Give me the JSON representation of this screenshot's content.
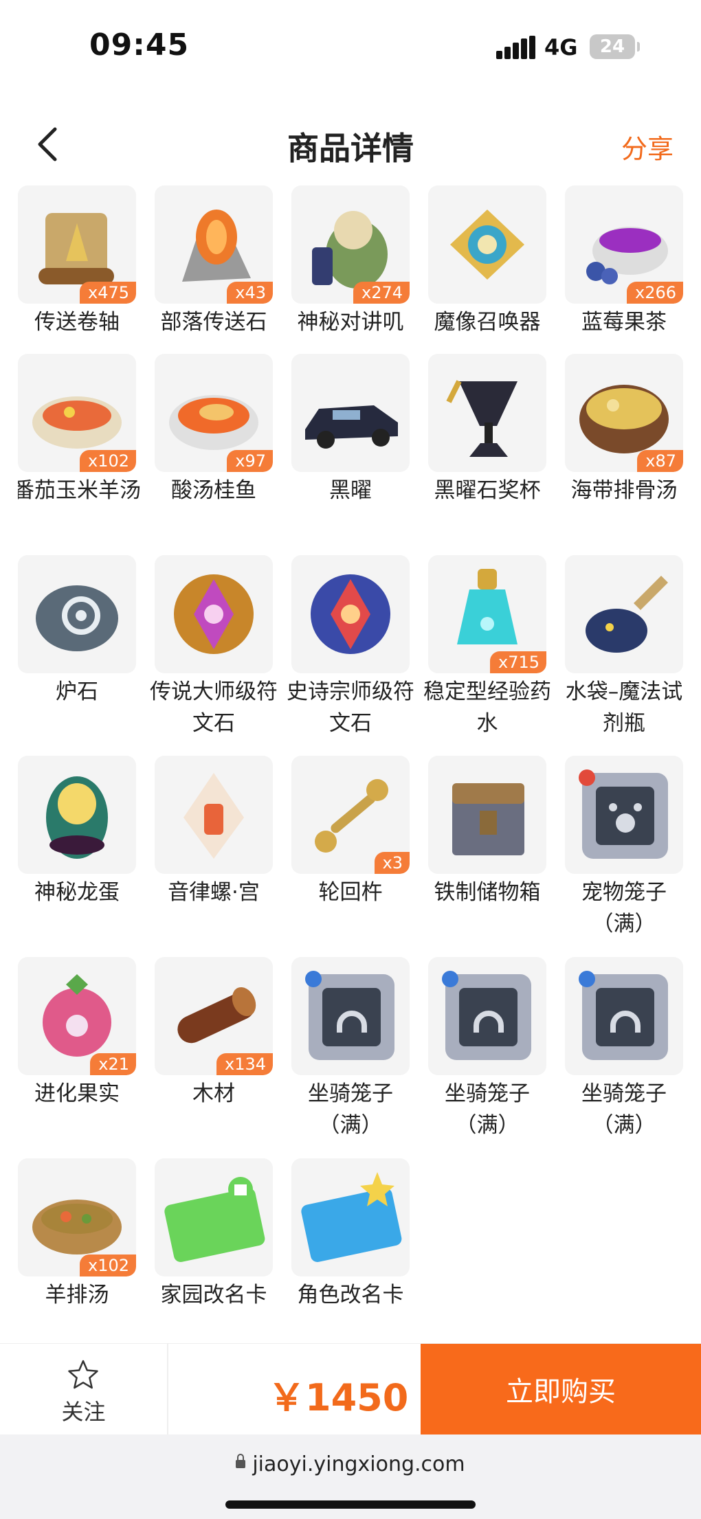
{
  "status_bar": {
    "time": "09:45",
    "network": "4G",
    "battery": "24"
  },
  "header": {
    "title": "商品详情",
    "share_label": "分享"
  },
  "items": [
    {
      "name": "传送卷轴",
      "count": "x475",
      "icon": "scroll-icon"
    },
    {
      "name": "部落传送石",
      "count": "x43",
      "icon": "teleport-stone-icon"
    },
    {
      "name": "神秘对讲叽",
      "count": "x274",
      "icon": "walkie-bird-icon"
    },
    {
      "name": "魔像召唤器",
      "count": "",
      "icon": "golem-summoner-icon"
    },
    {
      "name": "蓝莓果茶",
      "count": "x266",
      "icon": "blueberry-tea-icon"
    },
    {
      "name": "番茄玉米羊汤",
      "count": "x102",
      "icon": "tomato-corn-soup-icon"
    },
    {
      "name": "酸汤桂鱼",
      "count": "x97",
      "icon": "sour-fish-soup-icon"
    },
    {
      "name": "黑曜",
      "count": "",
      "icon": "black-car-icon"
    },
    {
      "name": "黑曜石奖杯",
      "count": "",
      "icon": "obsidian-trophy-icon"
    },
    {
      "name": "海带排骨汤",
      "count": "x87",
      "icon": "kelp-rib-soup-icon"
    },
    {
      "name": "炉石",
      "count": "",
      "icon": "hearthstone-icon"
    },
    {
      "name": "传说大师级符文石",
      "count": "",
      "icon": "legendary-rune-icon"
    },
    {
      "name": "史诗宗师级符文石",
      "count": "",
      "icon": "epic-rune-icon"
    },
    {
      "name": "稳定型经验药水",
      "count": "x715",
      "icon": "exp-potion-icon"
    },
    {
      "name": "水袋–魔法试剂瓶",
      "count": "",
      "icon": "magic-flask-icon"
    },
    {
      "name": "神秘龙蛋",
      "count": "",
      "icon": "dragon-egg-icon"
    },
    {
      "name": "音律螺·宫",
      "count": "",
      "icon": "conch-icon"
    },
    {
      "name": "轮回杵",
      "count": "x3",
      "icon": "pestle-icon"
    },
    {
      "name": "铁制储物箱",
      "count": "",
      "icon": "storage-chest-icon"
    },
    {
      "name": "宠物笼子（满）",
      "count": "",
      "icon": "pet-cage-icon"
    },
    {
      "name": "进化果实",
      "count": "x21",
      "icon": "evolution-fruit-icon"
    },
    {
      "name": "木材",
      "count": "x134",
      "icon": "wood-log-icon"
    },
    {
      "name": "坐骑笼子（满）",
      "count": "",
      "icon": "mount-cage-icon"
    },
    {
      "name": "坐骑笼子（满）",
      "count": "",
      "icon": "mount-cage-icon"
    },
    {
      "name": "坐骑笼子（满）",
      "count": "",
      "icon": "mount-cage-icon"
    },
    {
      "name": "羊排汤",
      "count": "x102",
      "icon": "lamb-soup-icon"
    },
    {
      "name": "家园改名卡",
      "count": "",
      "icon": "home-rename-card-icon"
    },
    {
      "name": "角色改名卡",
      "count": "",
      "icon": "role-rename-card-icon"
    }
  ],
  "bottom_bar": {
    "follow_label": "关注",
    "price": "￥1450",
    "buy_label": "立即购买"
  },
  "browser": {
    "url": "jiaoyi.yingxiong.com"
  },
  "colors": {
    "accent": "#f86a1b",
    "badge": "#f57c38"
  }
}
